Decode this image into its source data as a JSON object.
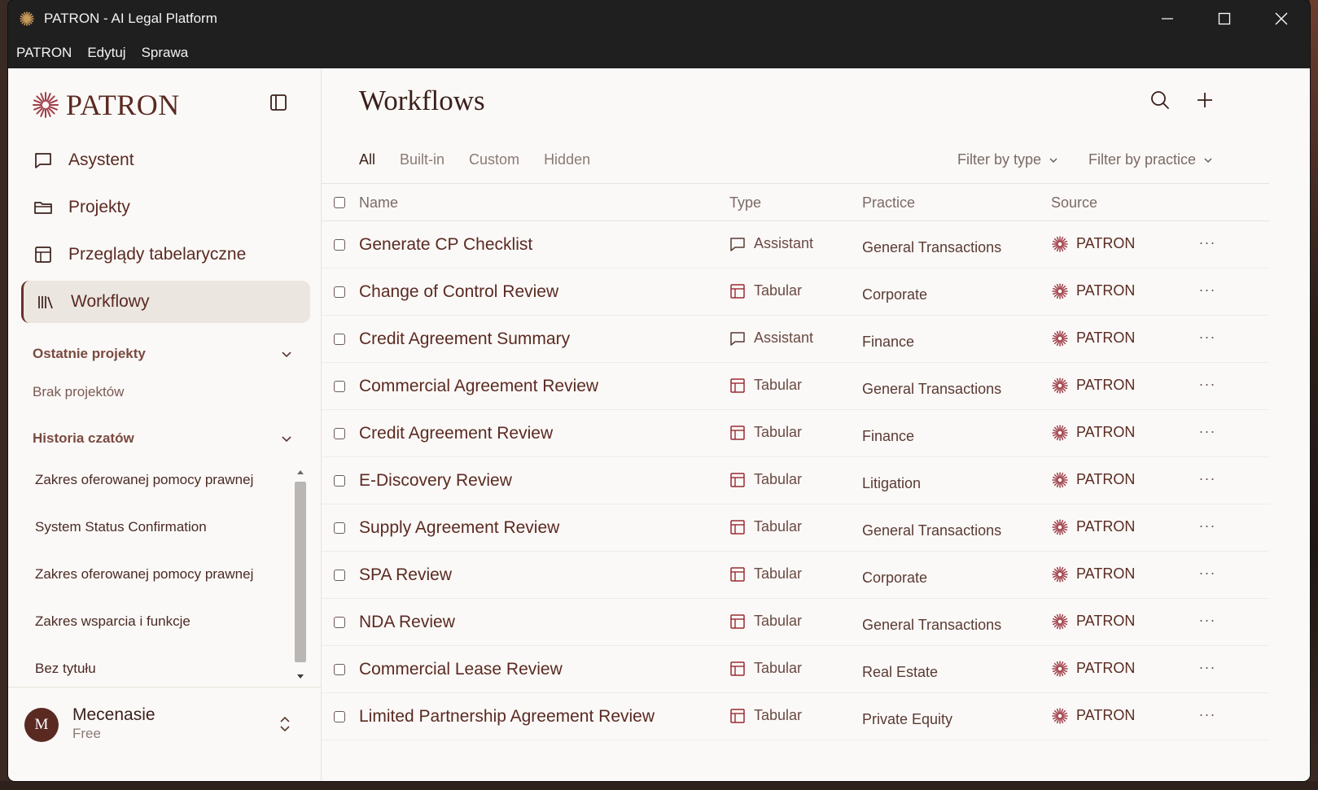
{
  "window": {
    "title": "PATRON - AI Legal Platform"
  },
  "menu": [
    "PATRON",
    "Edytuj",
    "Sprawa"
  ],
  "sidebar": {
    "brand": "PATRON",
    "nav": [
      {
        "label": "Asystent",
        "icon": "chat-icon"
      },
      {
        "label": "Projekty",
        "icon": "folder-icon"
      },
      {
        "label": "Przeglądy tabelaryczne",
        "icon": "table-icon"
      },
      {
        "label": "Workflowy",
        "icon": "library-icon",
        "active": true
      }
    ],
    "recent_projects": {
      "title": "Ostatnie projekty",
      "empty": "Brak projektów"
    },
    "chat_history": {
      "title": "Historia czatów",
      "items": [
        "Zakres oferowanej pomocy prawnej",
        "System Status Confirmation",
        "Zakres oferowanej pomocy prawnej",
        "Zakres wsparcia i funkcje",
        "Bez tytułu"
      ]
    },
    "user": {
      "initial": "M",
      "name": "Mecenasie",
      "plan": "Free"
    }
  },
  "main": {
    "title": "Workflows",
    "tabs": [
      {
        "label": "All",
        "active": true
      },
      {
        "label": "Built-in"
      },
      {
        "label": "Custom"
      },
      {
        "label": "Hidden"
      }
    ],
    "filter_type": "Filter by type",
    "filter_practice": "Filter by practice",
    "columns": {
      "name": "Name",
      "type": "Type",
      "practice": "Practice",
      "source": "Source"
    },
    "rows": [
      {
        "name": "Generate CP Checklist",
        "type": "Assistant",
        "practice": "General Transactions",
        "source": "PATRON"
      },
      {
        "name": "Change of Control Review",
        "type": "Tabular",
        "practice": "Corporate",
        "source": "PATRON"
      },
      {
        "name": "Credit Agreement Summary",
        "type": "Assistant",
        "practice": "Finance",
        "source": "PATRON"
      },
      {
        "name": "Commercial Agreement Review",
        "type": "Tabular",
        "practice": "General Transactions",
        "source": "PATRON"
      },
      {
        "name": "Credit Agreement Review",
        "type": "Tabular",
        "practice": "Finance",
        "source": "PATRON"
      },
      {
        "name": "E-Discovery Review",
        "type": "Tabular",
        "practice": "Litigation",
        "source": "PATRON"
      },
      {
        "name": "Supply Agreement Review",
        "type": "Tabular",
        "practice": "General Transactions",
        "source": "PATRON"
      },
      {
        "name": "SPA Review",
        "type": "Tabular",
        "practice": "Corporate",
        "source": "PATRON"
      },
      {
        "name": "NDA Review",
        "type": "Tabular",
        "practice": "General Transactions",
        "source": "PATRON"
      },
      {
        "name": "Commercial Lease Review",
        "type": "Tabular",
        "practice": "Real Estate",
        "source": "PATRON"
      },
      {
        "name": "Limited Partnership Agreement Review",
        "type": "Tabular",
        "practice": "Private Equity",
        "source": "PATRON"
      }
    ]
  },
  "colors": {
    "brand": "#5a2a22",
    "background": "#fbf9f7",
    "active_nav": "#ece6e1"
  }
}
